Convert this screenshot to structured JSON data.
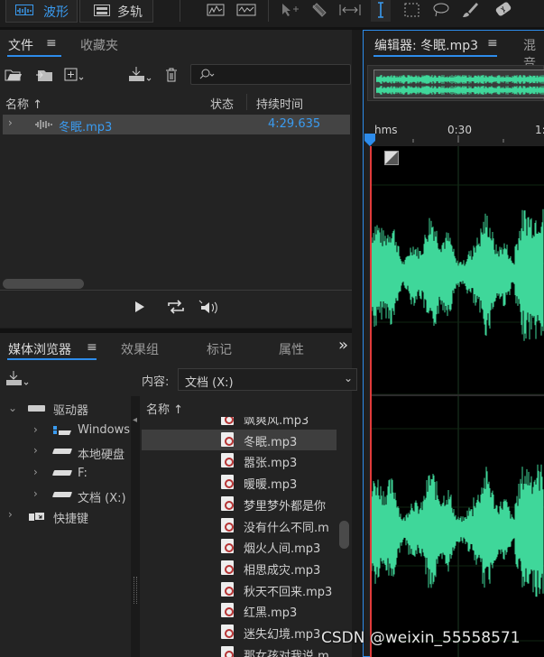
{
  "toolbar": {
    "waveform_label": "波形",
    "multitrack_label": "多轨"
  },
  "files_panel": {
    "tab_files": "文件",
    "tab_favorites": "收藏夹",
    "menu_icon": "≡",
    "search_placeholder": "",
    "col_name": "名称 ↑",
    "col_status": "状态",
    "col_duration": "持续时间",
    "file": {
      "name": "冬眠.mp3",
      "duration": "4:29.635"
    }
  },
  "editor": {
    "tab_label": "编辑器: 冬眠.mp3",
    "menu_icon": "≡",
    "next_tab": "混音",
    "timeline_hms": "hms",
    "timeline_ticks": [
      "0:30",
      "1:"
    ]
  },
  "media_browser": {
    "tab_media": "媒体浏览器",
    "menu_icon": "≡",
    "tab_effects": "效果组",
    "tab_markers": "标记",
    "tab_properties": "属性",
    "more_icon": "»",
    "content_label": "内容:",
    "content_value": "文档 (X:)",
    "tree": {
      "drives": "驱动器",
      "windows": "Windows",
      "local_disk": "本地硬盘",
      "f_drive": "F:",
      "docs": "文档 (X:)",
      "shortcuts": "快捷键"
    },
    "list_header": "名称 ↑",
    "files": [
      "飒爽风.mp3",
      "冬眠.mp3",
      "嚣张.mp3",
      "暖暖.mp3",
      "梦里梦外都是你",
      "没有什么不同.m",
      "烟火人间.mp3",
      "相思成灾.mp3",
      "秋天不回来.mp3",
      "红黑.mp3",
      "迷失幻境.mp3",
      "那女孩对我说.m"
    ]
  },
  "watermark": "CSDN @weixin_55558571",
  "colors": {
    "accent": "#2d8ceb",
    "waveform": "#3fd79a",
    "playhead": "#e23b3b"
  }
}
